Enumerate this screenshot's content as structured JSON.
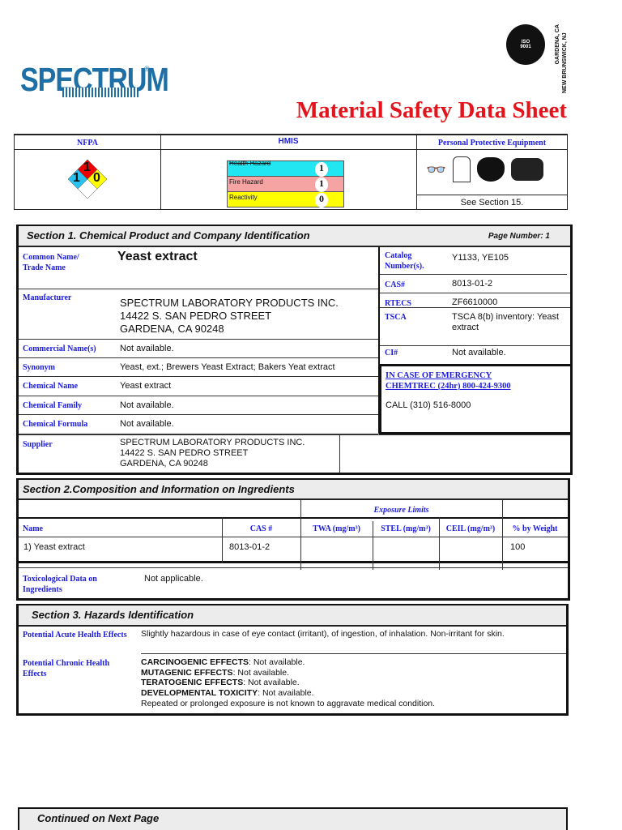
{
  "brand": {
    "logo_text": "SPECTRUM",
    "iso_seal": "ISO 9001 CERTIFIED",
    "locations": [
      "GARDENA, CA",
      "NEW BRUNSWICK, NJ"
    ]
  },
  "title": "Material Safety Data Sheet",
  "ratings": {
    "nfpa_label": "NFPA",
    "hmis_label": "HMIS",
    "ppe_label": "Personal Protective Equipment",
    "nfpa": {
      "health": "1",
      "fire": "1",
      "reactivity": "0"
    },
    "hmis": [
      {
        "label": "Health Hazard",
        "value": "1",
        "color": "#22e6f2"
      },
      {
        "label": "Fire Hazard",
        "value": "1",
        "color": "#f5a3a3"
      },
      {
        "label": "Reactivity",
        "value": "0",
        "color": "#ffff00"
      }
    ],
    "ppe_note": "See Section 15."
  },
  "section1": {
    "title": "Section 1. Chemical Product and Company Identification",
    "page_number": "Page Number: 1",
    "common_name_label": "Common Name/ Trade Name",
    "common_name": "Yeast extract",
    "manufacturer_label": "Manufacturer",
    "manufacturer": [
      "SPECTRUM LABORATORY PRODUCTS INC.",
      "14422 S. SAN PEDRO STREET",
      "GARDENA, CA 90248"
    ],
    "rows": [
      {
        "label": "Commercial Name(s)",
        "value": "Not available."
      },
      {
        "label": "Synonym",
        "value": "Yeast, ext.; Brewers Yeast Extract; Bakers Yeat extract"
      },
      {
        "label": "Chemical Name",
        "value": "Yeast extract"
      },
      {
        "label": "Chemical Family",
        "value": "Not available."
      },
      {
        "label": "Chemical Formula",
        "value": "Not available."
      }
    ],
    "supplier_label": "Supplier",
    "supplier": [
      "SPECTRUM LABORATORY PRODUCTS INC.",
      "14422 S. SAN PEDRO STREET",
      "GARDENA, CA 90248"
    ],
    "right": [
      {
        "label": "Catalog Number(s).",
        "value": "Y1133, YE105"
      },
      {
        "label": "CAS#",
        "value": "8013-01-2"
      },
      {
        "label": "RTECS",
        "value": "ZF6610000"
      },
      {
        "label": "TSCA",
        "value": "TSCA 8(b) inventory: Yeast extract"
      },
      {
        "label": "CI#",
        "value": "Not available."
      }
    ],
    "emergency": {
      "line1": "IN CASE OF EMERGENCY",
      "line2": "CHEMTREC (24hr) 800-424-9300",
      "call": "CALL (310) 516-8000"
    }
  },
  "section2": {
    "title": "Section 2.Composition and Information on Ingredients",
    "exposure_limits": "Exposure Limits",
    "headers": [
      "Name",
      "CAS #",
      "TWA (mg/m³)",
      "STEL (mg/m³)",
      "CEIL (mg/m³)",
      "% by Weight"
    ],
    "row": [
      "1) Yeast extract",
      "8013-01-2",
      "",
      "",
      "",
      "100"
    ],
    "tox_label": "Toxicological Data on Ingredients",
    "tox_value": "Not applicable."
  },
  "section3": {
    "title": "Section 3. Hazards Identification",
    "acute_label": "Potential Acute Health Effects",
    "acute": "Slightly hazardous in case of eye contact (irritant), of ingestion, of inhalation.  Non-irritant for skin.",
    "chronic_label": "Potential Chronic Health Effects",
    "chronic": [
      {
        "k": "CARCINOGENIC EFFECTS",
        "v": ": Not available."
      },
      {
        "k": "MUTAGENIC EFFECTS",
        "v": ": Not available."
      },
      {
        "k": "TERATOGENIC EFFECTS",
        "v": ": Not available."
      },
      {
        "k": "DEVELOPMENTAL TOXICITY",
        "v": ": Not available."
      }
    ],
    "chronic_note": "Repeated or prolonged exposure is not known to aggravate medical condition."
  },
  "footer": "Continued on Next Page"
}
